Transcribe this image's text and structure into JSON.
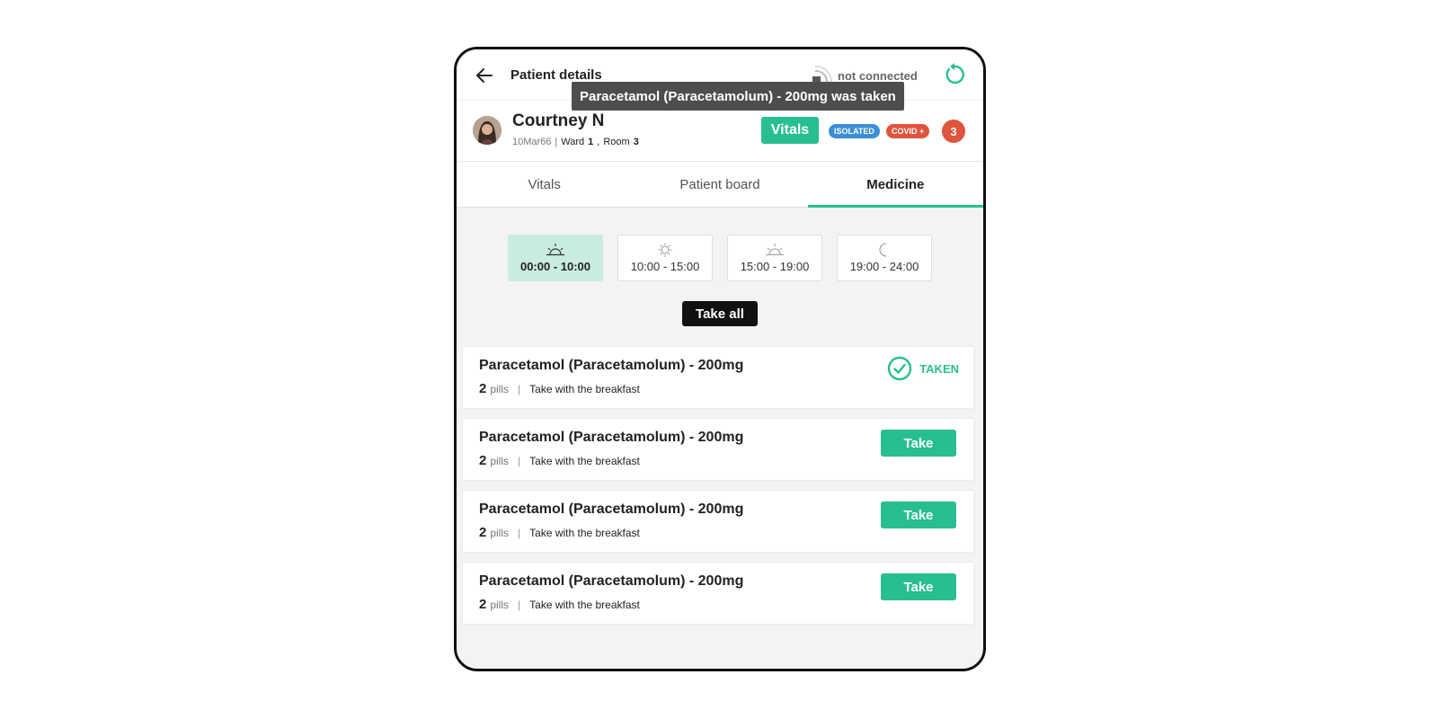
{
  "header": {
    "title": "Patient details",
    "connection_status": "not connected"
  },
  "toast": {
    "message": "Paracetamol (Paracetamolum) - 200mg was taken"
  },
  "patient": {
    "name": "Courtney N",
    "dob": "10Mar66",
    "ward_label": "Ward",
    "ward": "1",
    "room_label": "Room",
    "room": "3",
    "vitals_button": "Vitals",
    "badges": [
      "ISOLATED",
      "COVID +"
    ],
    "alert_count": "3"
  },
  "tabs": [
    {
      "label": "Vitals",
      "active": false
    },
    {
      "label": "Patient board",
      "active": false
    },
    {
      "label": "Medicine",
      "active": true
    }
  ],
  "time_slots": [
    {
      "label": "00:00 - 10:00",
      "icon": "sunrise-icon",
      "active": true
    },
    {
      "label": "10:00 - 15:00",
      "icon": "sun-icon",
      "active": false
    },
    {
      "label": "15:00 - 19:00",
      "icon": "sunset-icon",
      "active": false
    },
    {
      "label": "19:00 - 24:00",
      "icon": "moon-icon",
      "active": false
    }
  ],
  "take_all_label": "Take all",
  "medicines": [
    {
      "name": "Paracetamol (Paracetamolum) - 200mg",
      "count": "2",
      "unit": "pills",
      "instruction": "Take with the breakfast",
      "status": "TAKEN"
    },
    {
      "name": "Paracetamol (Paracetamolum) - 200mg",
      "count": "2",
      "unit": "pills",
      "instruction": "Take with the breakfast",
      "action": "Take"
    },
    {
      "name": "Paracetamol (Paracetamolum) - 200mg",
      "count": "2",
      "unit": "pills",
      "instruction": "Take with the breakfast",
      "action": "Take"
    },
    {
      "name": "Paracetamol (Paracetamolum) - 200mg",
      "count": "2",
      "unit": "pills",
      "instruction": "Take with the breakfast",
      "action": "Take"
    }
  ],
  "colors": {
    "accent": "#27bf91",
    "danger": "#e0533d",
    "info": "#3b8fd6",
    "toast_bg": "#4d4d4d",
    "active_slot_bg": "#c8ece0"
  }
}
